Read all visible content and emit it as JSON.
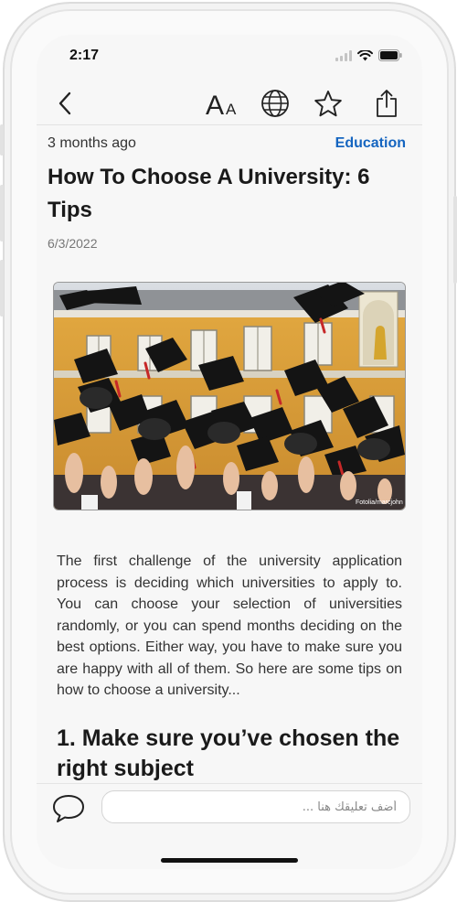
{
  "status_bar": {
    "time": "2:17"
  },
  "toolbar": {
    "icons": [
      "back-chevron-icon",
      "text-size-icon",
      "globe-icon",
      "star-icon",
      "share-icon"
    ]
  },
  "article": {
    "time_ago": "3 months ago",
    "category": "Education",
    "title": "How To Choose A University: 6 Tips",
    "date": "6/3/2022",
    "image_credit": "Fotolia/marcjohn",
    "body": "The first challenge of the university application process is deciding which universities to apply to. You can choose your selection of universities randomly, or you can spend months deciding on the best options. Either way, you have to make sure you are happy with all of them. So here are some tips on how to choose a university...",
    "section_heading": "1. Make sure you’ve chosen the right subject"
  },
  "comment_bar": {
    "placeholder": "أضف تعليقك هنا ..."
  },
  "colors": {
    "accent": "#1565c0",
    "background": "#f7f7f7",
    "text": "#1a1a1a"
  }
}
